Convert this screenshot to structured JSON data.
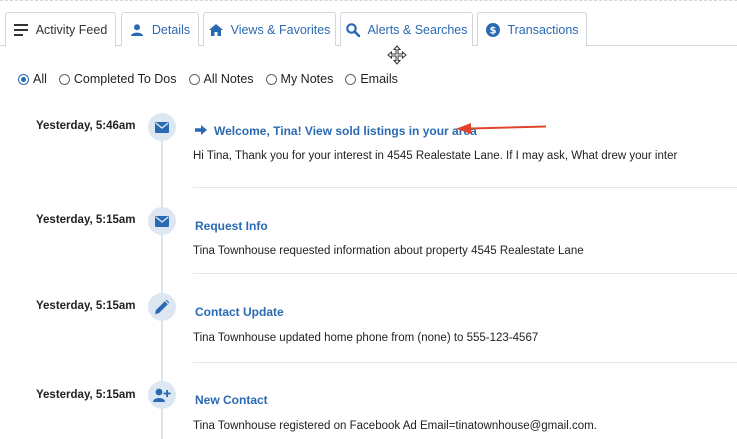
{
  "tabs": [
    {
      "label": "Activity Feed",
      "icon": "list-icon",
      "active": true
    },
    {
      "label": "Details",
      "icon": "person-icon",
      "active": false
    },
    {
      "label": "Views & Favorites",
      "icon": "home-icon",
      "active": false
    },
    {
      "label": "Alerts & Searches",
      "icon": "search-icon",
      "active": false
    },
    {
      "label": "Transactions",
      "icon": "dollar-icon",
      "active": false
    }
  ],
  "filters": [
    {
      "label": "All",
      "checked": true
    },
    {
      "label": "Completed To Dos",
      "checked": false
    },
    {
      "label": "All Notes",
      "checked": false
    },
    {
      "label": "My Notes",
      "checked": false
    },
    {
      "label": "Emails",
      "checked": false
    }
  ],
  "entries": [
    {
      "time": "Yesterday, 5:46am",
      "icon": "envelope-icon",
      "title": "Welcome, Tina! View sold listings in your area",
      "title_icon": "arrow-right-icon",
      "body": "Hi Tina, Thank you for your interest in 4545 Realestate Lane. If I may ask, What drew your inter"
    },
    {
      "time": "Yesterday, 5:15am",
      "icon": "envelope-icon",
      "title": "Request Info",
      "body": "Tina Townhouse  requested information about property 4545 Realestate Lane"
    },
    {
      "time": "Yesterday, 5:15am",
      "icon": "pencil-icon",
      "title": "Contact Update",
      "body": "Tina Townhouse updated home phone from (none) to 555-123-4567"
    },
    {
      "time": "Yesterday, 5:15am",
      "icon": "person-add-icon",
      "title": "New Contact",
      "body": "Tina Townhouse registered on Facebook Ad Email=tinatownhouse@gmail.com."
    }
  ],
  "colors": {
    "accent": "#2a6ab3",
    "annotation_arrow": "#e0452b",
    "icon_circle": "#dde7f1"
  }
}
